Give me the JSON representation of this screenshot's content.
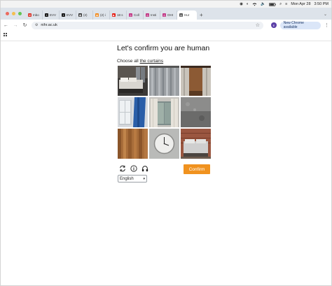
{
  "menubar": {
    "date_time_1": "Mon Apr 28",
    "date_time_2": "3:50 PM"
  },
  "tabs": [
    {
      "label": "Inbo",
      "favicon": "gmail-icon",
      "glyph": "M",
      "color": "#d93025"
    },
    {
      "label": "EVV",
      "favicon": "x-icon",
      "glyph": "X",
      "color": "#111111"
    },
    {
      "label": "EVV",
      "favicon": "x-icon",
      "glyph": "X",
      "color": "#111111"
    },
    {
      "label": "(2)",
      "favicon": "app-icon",
      "glyph": "▦",
      "color": "#333333"
    },
    {
      "label": "(2) i",
      "favicon": "rss-icon",
      "glyph": "◉",
      "color": "#f28b1e"
    },
    {
      "label": "18 s",
      "favicon": "youtube-icon",
      "glyph": "▶",
      "color": "#e62117"
    },
    {
      "label": "Coll",
      "favicon": "instagram-icon",
      "glyph": "◎",
      "color": "#c13584"
    },
    {
      "label": "Insti",
      "favicon": "instagram-icon",
      "glyph": "◎",
      "color": "#c13584"
    },
    {
      "label": "OHI",
      "favicon": "instagram-icon",
      "glyph": "◎",
      "color": "#c13584"
    },
    {
      "label": "Hur",
      "favicon": "globe-icon",
      "glyph": "◍",
      "color": "#555555",
      "active": true
    }
  ],
  "toolbar": {
    "url": "nihr.ac.uk",
    "profile_initial": "E",
    "new_chrome_label": "New Chrome available"
  },
  "captcha": {
    "title": "Let's confirm you are human",
    "instruction_prefix": "Choose all ",
    "instruction_target": "the curtains",
    "images": [
      {
        "subject": "bedroom with curtains"
      },
      {
        "subject": "grey curtains"
      },
      {
        "subject": "curtains on wood wall"
      },
      {
        "subject": "blue curtain by window"
      },
      {
        "subject": "window with sheer curtains"
      },
      {
        "subject": "grey textured wall"
      },
      {
        "subject": "wooden slats"
      },
      {
        "subject": "wall clock"
      },
      {
        "subject": "bedroom with brick wall"
      }
    ],
    "confirm_label": "Confirm",
    "language": "English"
  },
  "colors": {
    "accent": "#f0921f",
    "tabstrip": "#dde3ea",
    "chrome_badge": "#dbe6f8"
  }
}
